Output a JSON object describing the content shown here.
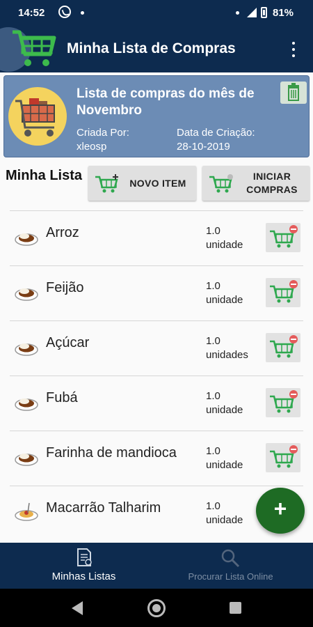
{
  "status_bar": {
    "time": "14:52",
    "battery": "81%"
  },
  "app_bar": {
    "title": "Minha Lista de Compras"
  },
  "list_card": {
    "title": "Lista de compras do mês de Novembro",
    "created_by_label": "Criada Por:",
    "created_by": "xleosp",
    "creation_date_label": "Data de Criação:",
    "creation_date": "28-10-2019"
  },
  "section": {
    "title": "Minha Lista",
    "new_item_label": "NOVO ITEM",
    "start_shopping_label": "INICIAR COMPRAS"
  },
  "items": [
    {
      "name": "Arroz",
      "quantity": "1.0",
      "unit": "unidade",
      "icon": "food-plate-icon"
    },
    {
      "name": "Feijão",
      "quantity": "1.0",
      "unit": "unidade",
      "icon": "food-plate-icon"
    },
    {
      "name": "Açúcar",
      "quantity": "1.0",
      "unit": "unidades",
      "icon": "food-plate-icon"
    },
    {
      "name": "Fubá",
      "quantity": "1.0",
      "unit": "unidade",
      "icon": "food-plate-icon"
    },
    {
      "name": "Farinha de mandioca",
      "quantity": "1.0",
      "unit": "unidade",
      "icon": "food-plate-icon"
    },
    {
      "name": "Macarrão Talharim",
      "quantity": "1.0",
      "unit": "unidade",
      "icon": "pasta-plate-icon"
    }
  ],
  "fab": {
    "label": "+"
  },
  "bottom_nav": {
    "tabs": [
      {
        "label": "Minhas Listas",
        "active": true
      },
      {
        "label": "Procurar Lista Online",
        "active": false
      }
    ]
  },
  "colors": {
    "primary": "#0d2b4f",
    "card": "#6c8cb5",
    "accent_green": "#1e6b24",
    "cart_green": "#2fa84f"
  }
}
